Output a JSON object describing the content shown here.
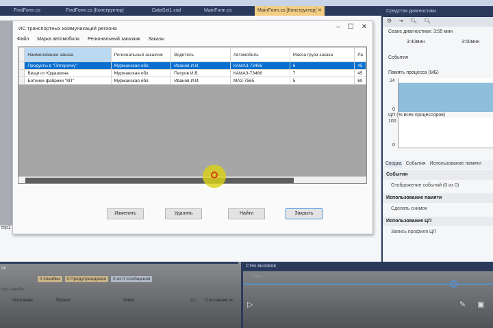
{
  "ide": {
    "tabs": [
      "FindForm.cs",
      "FindForm.cs [Конструктор]",
      "DataSet1.xsd",
      "MainForm.cs",
      "MainForm.cs [Конструктор]"
    ],
    "active_tab_index": 4,
    "left_hint": "trip1"
  },
  "dialog": {
    "title": "ИС транспортных коммуникаций региона",
    "menu": [
      "Файл",
      "Марка автомобиля",
      "Региональный заказчик",
      "Заказы"
    ],
    "columns": [
      "Наименование заказа",
      "Региональный заказчик",
      "Водитель",
      "Автомобиль",
      "Масса груза заказа",
      "Ра"
    ],
    "rows": [
      [
        "Продукты в \"Пятерочку\"",
        "Мурманская обл.",
        "Иванов И.И.",
        "КАМАЗ-73466",
        "6",
        "45"
      ],
      [
        "Вещи от Юдашкина",
        "Мурманская обл.",
        "Петров И.В.",
        "КАМАЗ-73466",
        "7",
        "45"
      ],
      [
        "Ботинки фабрики \"КП\"",
        "Мурманская обл.",
        "Иванов И.И.",
        "МАЗ-7565",
        "5",
        "60"
      ]
    ],
    "selected_row": 0,
    "buttons": {
      "edit": "Изменить",
      "delete": "Удалить",
      "find": "Найти",
      "close": "Закрыть"
    }
  },
  "diagnostics": {
    "title": "Средства диагностики",
    "session": "Сеанс диагностики: 3:55 мин",
    "ticks": [
      "3:40мин",
      "3:50мин"
    ],
    "events_label": "События",
    "memory_label": "Память процесса (МБ)",
    "memory_max": "24",
    "memory_min": "0",
    "cpu_label": "ЦП (% всех процессоров)",
    "cpu_max": "100",
    "cpu_min": "0",
    "tabs": [
      "Сводка",
      "События",
      "Использование памяти"
    ],
    "sections": [
      {
        "header": "События",
        "item": "Отображение событий (0 из 0)"
      },
      {
        "header": "Использование памяти",
        "item": "Сделать снимок"
      },
      {
        "header": "Использование ЦП",
        "item": "Запись профиля ЦП"
      }
    ]
  },
  "errors_panel": {
    "title": "ок",
    "errors": "0 Ошибки",
    "warnings": "0 Предупреждения",
    "messages": "0 из 0 Сообщения",
    "search_placeholder": "ску ошибок",
    "columns": [
      "Описание",
      "Проект",
      "Файл",
      "Ст...",
      "Состояние по"
    ]
  },
  "stack_panel": {
    "title": "Стек вызовов",
    "column": "Имя"
  }
}
